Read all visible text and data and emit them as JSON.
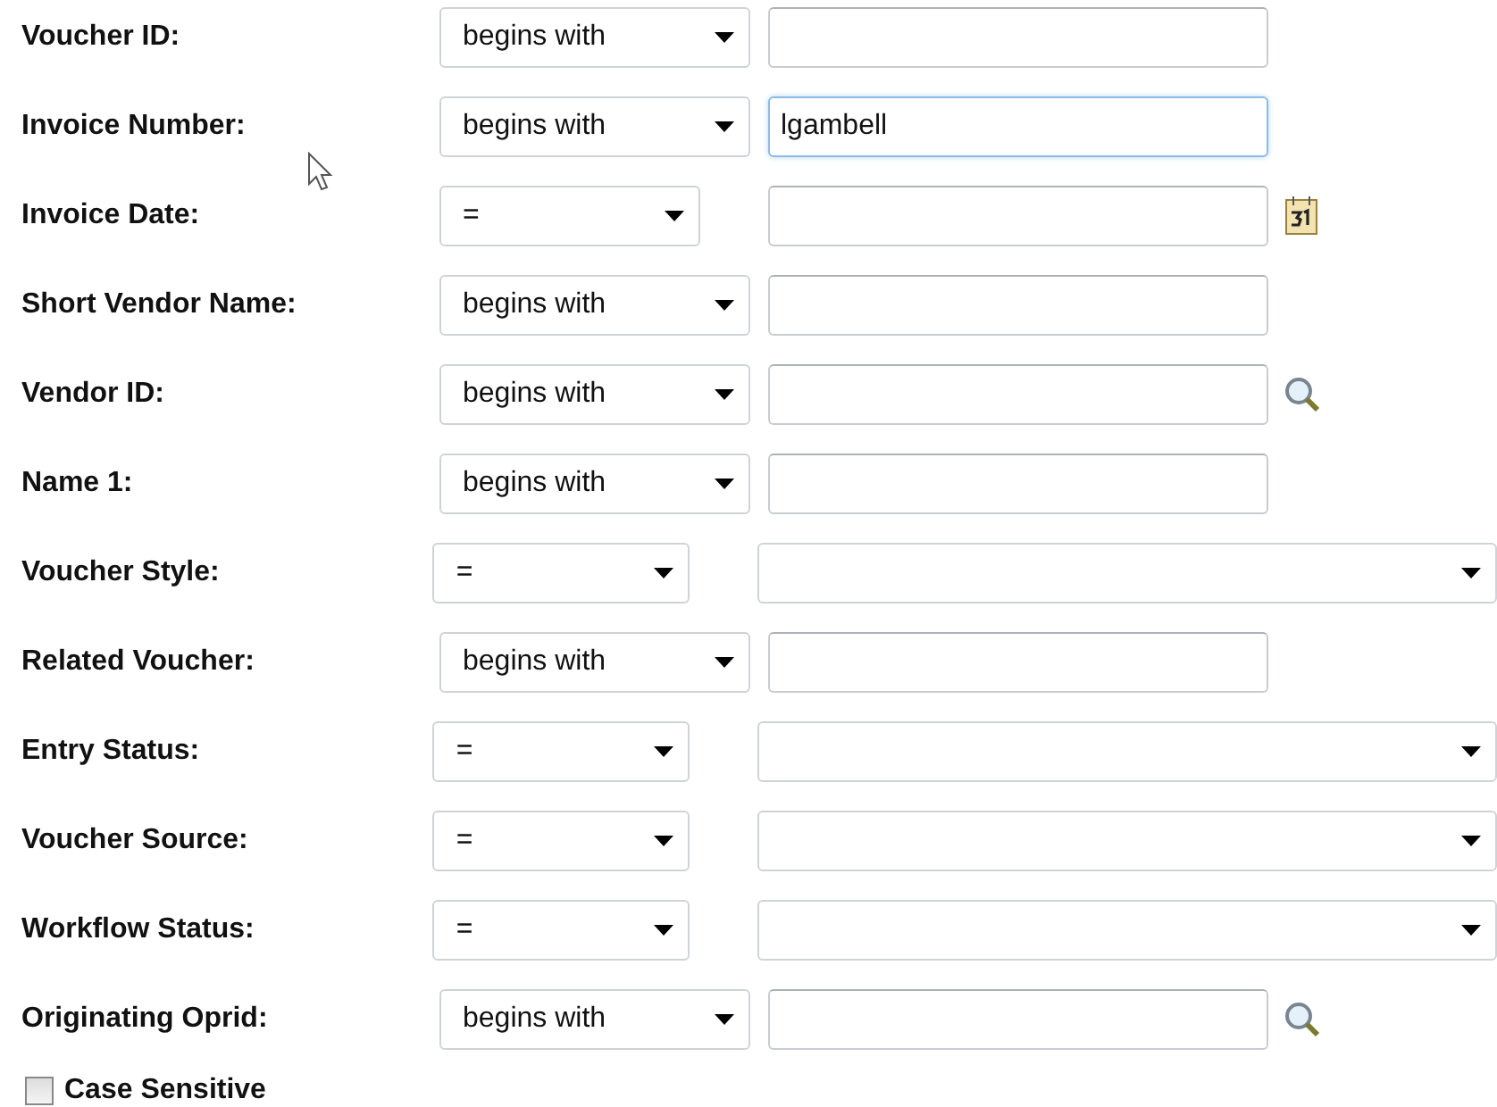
{
  "criteria": [
    {
      "label": "Voucher ID:",
      "operator": "begins with",
      "kind": "text",
      "focused": false
    },
    {
      "label": "Invoice Number:",
      "operator": "begins with",
      "kind": "text",
      "value": "lgambell",
      "focused": true
    },
    {
      "label": "Invoice Date:",
      "operator": "=",
      "kind": "date",
      "focused": false
    },
    {
      "label": "Short Vendor Name:",
      "operator": "begins with",
      "kind": "text",
      "focused": false
    },
    {
      "label": "Vendor ID:",
      "operator": "begins with",
      "kind": "lookup",
      "focused": false
    },
    {
      "label": "Name 1:",
      "operator": "begins with",
      "kind": "text",
      "focused": false
    },
    {
      "label": "Voucher Style:",
      "operator": "=",
      "kind": "select",
      "focused": false
    },
    {
      "label": "Related Voucher:",
      "operator": "begins with",
      "kind": "text",
      "focused": false
    },
    {
      "label": "Entry Status:",
      "operator": "=",
      "kind": "select",
      "focused": false
    },
    {
      "label": "Voucher Source:",
      "operator": "=",
      "kind": "select",
      "focused": false
    },
    {
      "label": "Workflow Status:",
      "operator": "=",
      "kind": "select",
      "focused": false
    },
    {
      "label": "Originating Oprid:",
      "operator": "begins with",
      "kind": "lookup",
      "focused": false
    }
  ],
  "case_sensitive": {
    "label": "Case Sensitive",
    "checked": false
  }
}
